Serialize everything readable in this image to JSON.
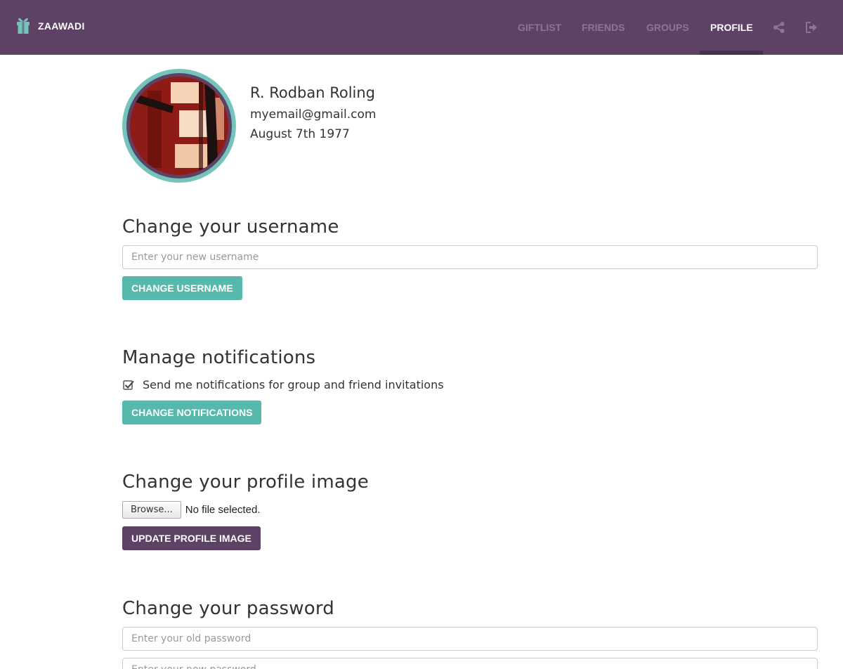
{
  "nav": {
    "brand": "ZAAWADI",
    "links": [
      {
        "label": "GIFTLIST",
        "active": false
      },
      {
        "label": "FRIENDS",
        "active": false
      },
      {
        "label": "GROUPS",
        "active": false
      },
      {
        "label": "PROFILE",
        "active": true
      }
    ],
    "icons": [
      "share-icon",
      "sign-out-icon"
    ]
  },
  "profile": {
    "name": "R. Rodban Roling",
    "email": "myemail@gmail.com",
    "birthday": "August 7th 1977"
  },
  "username_section": {
    "title": "Change your username",
    "placeholder": "Enter your new username",
    "button": "CHANGE USERNAME"
  },
  "notifications_section": {
    "title": "Manage notifications",
    "checkbox_label": "Send me notifications for group and friend invitations",
    "checked": true,
    "button": "CHANGE NOTIFICATIONS"
  },
  "image_section": {
    "title": "Change your profile image",
    "browse_label": "Browse...",
    "file_status": "No file selected.",
    "button": "UPDATE PROFILE IMAGE"
  },
  "password_section": {
    "title": "Change your password",
    "old_placeholder": "Enter your old password",
    "new_placeholder": "Enter your new password"
  },
  "colors": {
    "navbar": "#5e4266",
    "accent_teal": "#57b8ac",
    "accent_purple": "#5e4266",
    "avatar_ring": "#75c4bc"
  }
}
